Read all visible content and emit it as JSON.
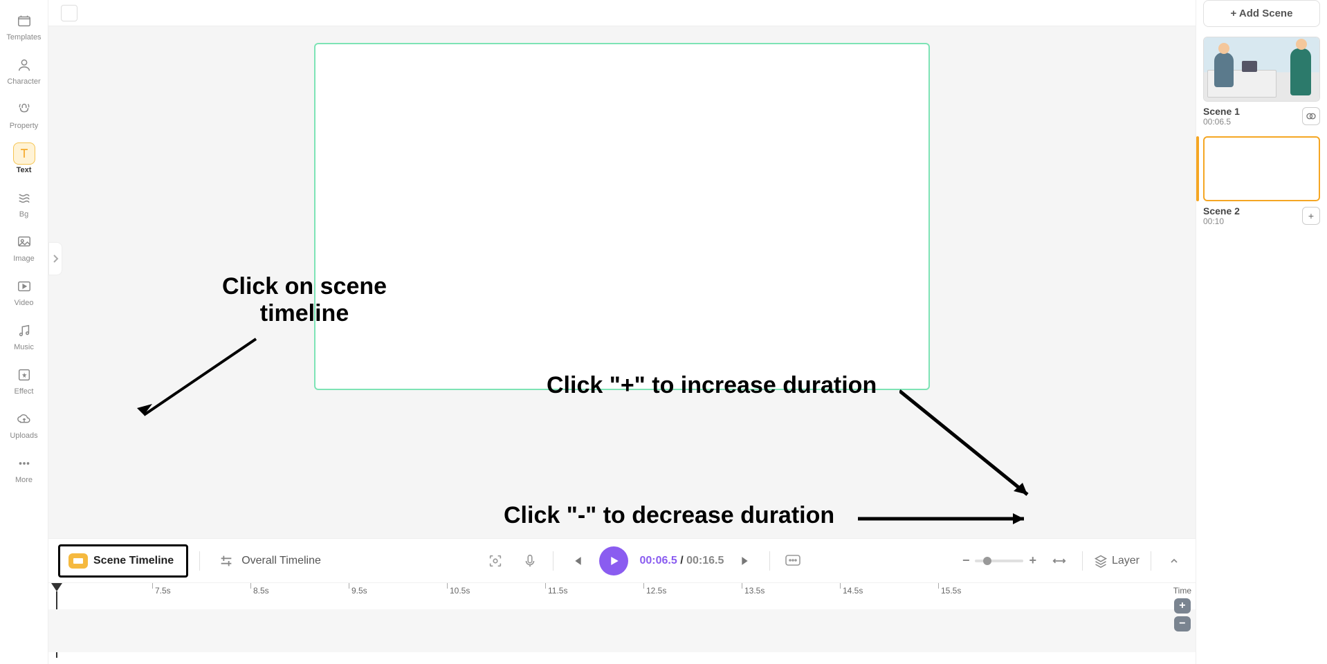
{
  "sidebar": {
    "items": [
      {
        "label": "Templates",
        "icon": "templates-icon"
      },
      {
        "label": "Character",
        "icon": "character-icon"
      },
      {
        "label": "Property",
        "icon": "property-icon"
      },
      {
        "label": "Text",
        "icon": "text-icon",
        "active": true
      },
      {
        "label": "Bg",
        "icon": "bg-icon"
      },
      {
        "label": "Image",
        "icon": "image-icon"
      },
      {
        "label": "Video",
        "icon": "video-icon"
      },
      {
        "label": "Music",
        "icon": "music-icon"
      },
      {
        "label": "Effect",
        "icon": "effect-icon"
      },
      {
        "label": "Uploads",
        "icon": "uploads-icon"
      },
      {
        "label": "More",
        "icon": "more-icon"
      }
    ]
  },
  "right": {
    "add_scene_label": "+ Add Scene",
    "scenes": [
      {
        "title": "Scene 1",
        "time": "00:06.5",
        "action": "link"
      },
      {
        "title": "Scene 2",
        "time": "00:10",
        "action": "plus",
        "selected": true
      }
    ]
  },
  "timeline_bar": {
    "scene_timeline_label": "Scene Timeline",
    "overall_timeline_label": "Overall Timeline",
    "time_current": "00:06.5",
    "time_total": "00:16.5",
    "layer_label": "Layer",
    "zoom_minus": "−",
    "zoom_plus": "+",
    "time_separator": " / "
  },
  "ruler": {
    "ticks": [
      "7.5s",
      "8.5s",
      "9.5s",
      "10.5s",
      "11.5s",
      "12.5s",
      "13.5s",
      "14.5s",
      "15.5s"
    ],
    "time_label": "Time",
    "plus": "+",
    "minus": "−"
  },
  "annotations": {
    "a1_line1": "Click on scene",
    "a1_line2": "timeline",
    "a2": "Click \"+\" to increase duration",
    "a3": "Click \"-\" to decrease duration"
  }
}
